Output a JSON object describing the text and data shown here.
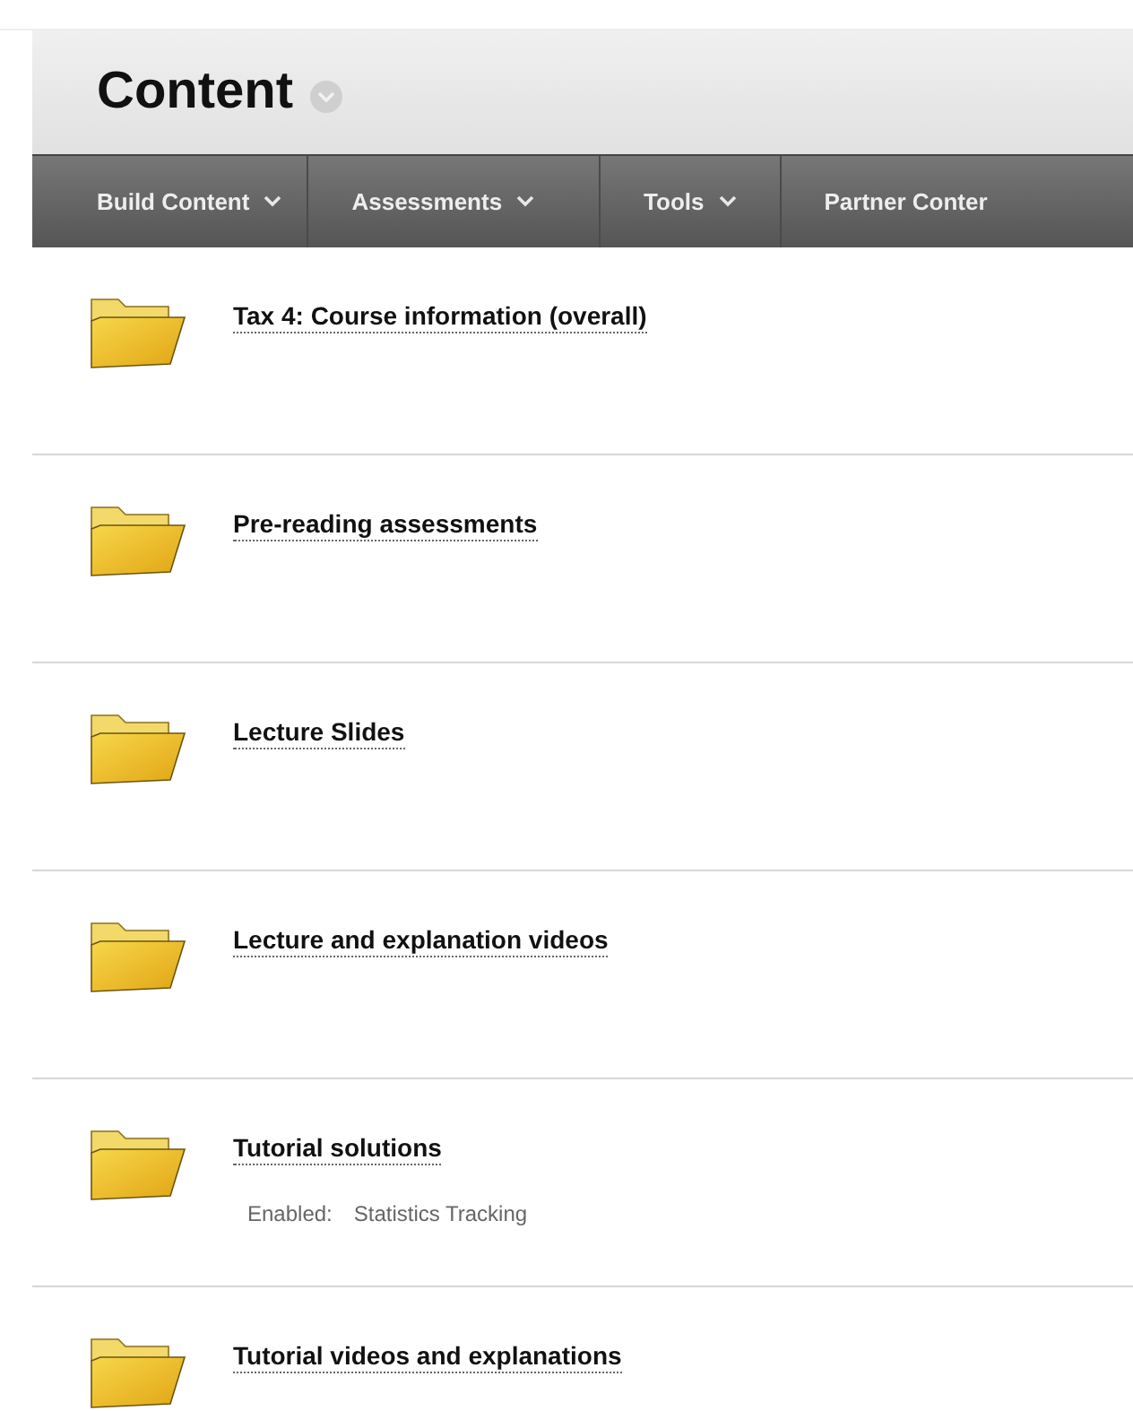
{
  "page_title": "Content",
  "menu": [
    {
      "label": "Build Content",
      "has_caret": true
    },
    {
      "label": "Assessments",
      "has_caret": true
    },
    {
      "label": "Tools",
      "has_caret": true
    },
    {
      "label": "Partner Conter",
      "has_caret": false
    }
  ],
  "items": [
    {
      "title": "Tax 4: Course information (overall)"
    },
    {
      "title": "Pre-reading assessments"
    },
    {
      "title": "Lecture Slides"
    },
    {
      "title": "Lecture and explanation videos"
    },
    {
      "title": "Tutorial solutions",
      "details": [
        {
          "label": "Enabled:",
          "value": "Statistics Tracking"
        }
      ]
    },
    {
      "title": "Tutorial videos and explanations"
    }
  ]
}
